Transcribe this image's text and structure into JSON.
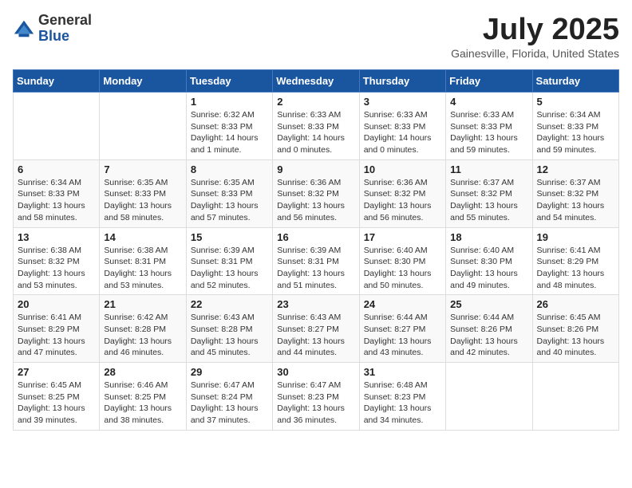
{
  "header": {
    "logo_general": "General",
    "logo_blue": "Blue",
    "month_title": "July 2025",
    "location": "Gainesville, Florida, United States"
  },
  "weekdays": [
    "Sunday",
    "Monday",
    "Tuesday",
    "Wednesday",
    "Thursday",
    "Friday",
    "Saturday"
  ],
  "weeks": [
    [
      {
        "day": "",
        "info": ""
      },
      {
        "day": "",
        "info": ""
      },
      {
        "day": "1",
        "info": "Sunrise: 6:32 AM\nSunset: 8:33 PM\nDaylight: 14 hours and 1 minute."
      },
      {
        "day": "2",
        "info": "Sunrise: 6:33 AM\nSunset: 8:33 PM\nDaylight: 14 hours and 0 minutes."
      },
      {
        "day": "3",
        "info": "Sunrise: 6:33 AM\nSunset: 8:33 PM\nDaylight: 14 hours and 0 minutes."
      },
      {
        "day": "4",
        "info": "Sunrise: 6:33 AM\nSunset: 8:33 PM\nDaylight: 13 hours and 59 minutes."
      },
      {
        "day": "5",
        "info": "Sunrise: 6:34 AM\nSunset: 8:33 PM\nDaylight: 13 hours and 59 minutes."
      }
    ],
    [
      {
        "day": "6",
        "info": "Sunrise: 6:34 AM\nSunset: 8:33 PM\nDaylight: 13 hours and 58 minutes."
      },
      {
        "day": "7",
        "info": "Sunrise: 6:35 AM\nSunset: 8:33 PM\nDaylight: 13 hours and 58 minutes."
      },
      {
        "day": "8",
        "info": "Sunrise: 6:35 AM\nSunset: 8:33 PM\nDaylight: 13 hours and 57 minutes."
      },
      {
        "day": "9",
        "info": "Sunrise: 6:36 AM\nSunset: 8:32 PM\nDaylight: 13 hours and 56 minutes."
      },
      {
        "day": "10",
        "info": "Sunrise: 6:36 AM\nSunset: 8:32 PM\nDaylight: 13 hours and 56 minutes."
      },
      {
        "day": "11",
        "info": "Sunrise: 6:37 AM\nSunset: 8:32 PM\nDaylight: 13 hours and 55 minutes."
      },
      {
        "day": "12",
        "info": "Sunrise: 6:37 AM\nSunset: 8:32 PM\nDaylight: 13 hours and 54 minutes."
      }
    ],
    [
      {
        "day": "13",
        "info": "Sunrise: 6:38 AM\nSunset: 8:32 PM\nDaylight: 13 hours and 53 minutes."
      },
      {
        "day": "14",
        "info": "Sunrise: 6:38 AM\nSunset: 8:31 PM\nDaylight: 13 hours and 53 minutes."
      },
      {
        "day": "15",
        "info": "Sunrise: 6:39 AM\nSunset: 8:31 PM\nDaylight: 13 hours and 52 minutes."
      },
      {
        "day": "16",
        "info": "Sunrise: 6:39 AM\nSunset: 8:31 PM\nDaylight: 13 hours and 51 minutes."
      },
      {
        "day": "17",
        "info": "Sunrise: 6:40 AM\nSunset: 8:30 PM\nDaylight: 13 hours and 50 minutes."
      },
      {
        "day": "18",
        "info": "Sunrise: 6:40 AM\nSunset: 8:30 PM\nDaylight: 13 hours and 49 minutes."
      },
      {
        "day": "19",
        "info": "Sunrise: 6:41 AM\nSunset: 8:29 PM\nDaylight: 13 hours and 48 minutes."
      }
    ],
    [
      {
        "day": "20",
        "info": "Sunrise: 6:41 AM\nSunset: 8:29 PM\nDaylight: 13 hours and 47 minutes."
      },
      {
        "day": "21",
        "info": "Sunrise: 6:42 AM\nSunset: 8:28 PM\nDaylight: 13 hours and 46 minutes."
      },
      {
        "day": "22",
        "info": "Sunrise: 6:43 AM\nSunset: 8:28 PM\nDaylight: 13 hours and 45 minutes."
      },
      {
        "day": "23",
        "info": "Sunrise: 6:43 AM\nSunset: 8:27 PM\nDaylight: 13 hours and 44 minutes."
      },
      {
        "day": "24",
        "info": "Sunrise: 6:44 AM\nSunset: 8:27 PM\nDaylight: 13 hours and 43 minutes."
      },
      {
        "day": "25",
        "info": "Sunrise: 6:44 AM\nSunset: 8:26 PM\nDaylight: 13 hours and 42 minutes."
      },
      {
        "day": "26",
        "info": "Sunrise: 6:45 AM\nSunset: 8:26 PM\nDaylight: 13 hours and 40 minutes."
      }
    ],
    [
      {
        "day": "27",
        "info": "Sunrise: 6:45 AM\nSunset: 8:25 PM\nDaylight: 13 hours and 39 minutes."
      },
      {
        "day": "28",
        "info": "Sunrise: 6:46 AM\nSunset: 8:25 PM\nDaylight: 13 hours and 38 minutes."
      },
      {
        "day": "29",
        "info": "Sunrise: 6:47 AM\nSunset: 8:24 PM\nDaylight: 13 hours and 37 minutes."
      },
      {
        "day": "30",
        "info": "Sunrise: 6:47 AM\nSunset: 8:23 PM\nDaylight: 13 hours and 36 minutes."
      },
      {
        "day": "31",
        "info": "Sunrise: 6:48 AM\nSunset: 8:23 PM\nDaylight: 13 hours and 34 minutes."
      },
      {
        "day": "",
        "info": ""
      },
      {
        "day": "",
        "info": ""
      }
    ]
  ]
}
